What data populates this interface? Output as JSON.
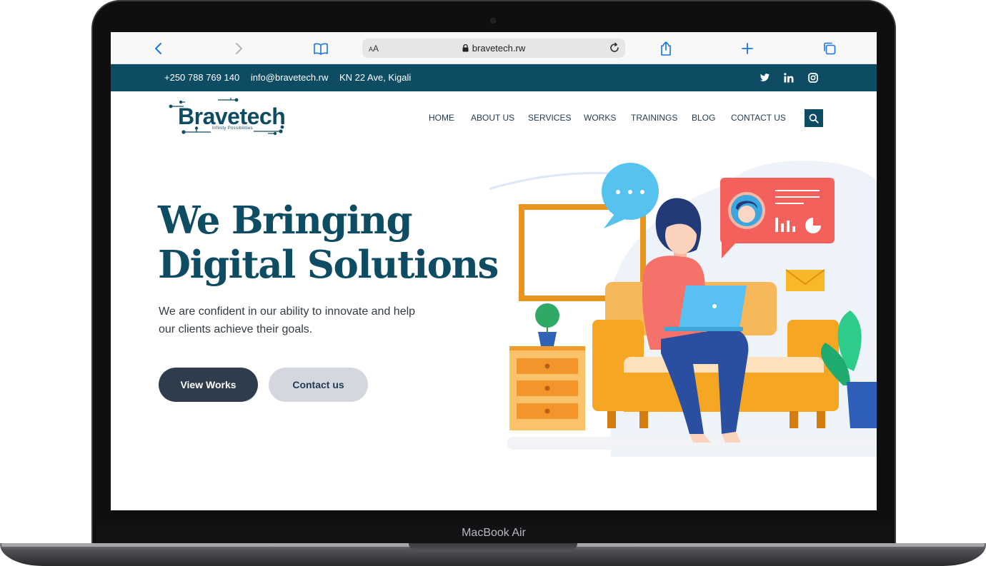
{
  "device": {
    "label": "MacBook Air"
  },
  "browser": {
    "text_size_label": "AA",
    "url": "bravetech.rw",
    "icons": [
      "back-icon",
      "forward-icon",
      "bookmarks-icon",
      "lock-icon",
      "reload-icon",
      "share-icon",
      "new-tab-icon",
      "tabs-icon"
    ]
  },
  "topbar": {
    "phone": "+250 788 769 140",
    "email": "info@bravetech.rw",
    "address": "KN 22 Ave, Kigali",
    "social": [
      "twitter-icon",
      "linkedin-icon",
      "instagram-icon"
    ],
    "background": "#0e4c63"
  },
  "logo": {
    "name": "Bravetech",
    "tagline": "Infinity Possibilities"
  },
  "nav": {
    "items": [
      "HOME",
      "ABOUT US",
      "SERVICES",
      "WORKS",
      "TRAININGS",
      "BLOG",
      "CONTACT US"
    ]
  },
  "hero": {
    "title_line1": "We Bringing",
    "title_line2": "Digital Solutions",
    "description": "We are confident in our ability to innovate and help our clients achieve their goals.",
    "primary_button": "View Works",
    "secondary_button": "Contact us"
  },
  "colors": {
    "brand": "#0e4c63",
    "primary_button": "#2f3c4c",
    "secondary_button": "#d4d8de"
  }
}
